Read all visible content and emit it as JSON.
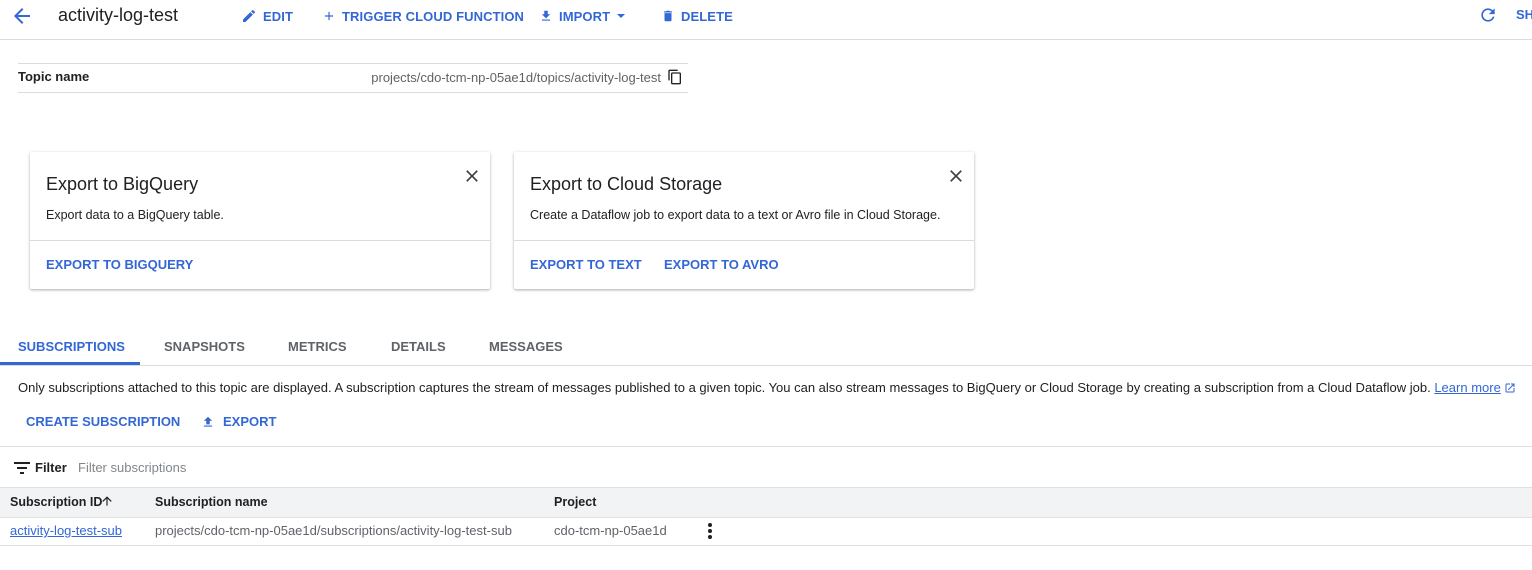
{
  "header": {
    "title": "activity-log-test",
    "actions": {
      "edit": "EDIT",
      "trigger": "TRIGGER CLOUD FUNCTION",
      "import": "IMPORT",
      "delete": "DELETE",
      "share": "SH"
    }
  },
  "topic": {
    "label": "Topic name",
    "value": "projects/cdo-tcm-np-05ae1d/topics/activity-log-test"
  },
  "cards": [
    {
      "title": "Export to BigQuery",
      "description": "Export data to a BigQuery table.",
      "actions": [
        "EXPORT TO BIGQUERY"
      ]
    },
    {
      "title": "Export to Cloud Storage",
      "description": "Create a Dataflow job to export data to a text or Avro file in Cloud Storage.",
      "actions": [
        "EXPORT TO TEXT",
        "EXPORT TO AVRO"
      ]
    }
  ],
  "tabs": [
    "SUBSCRIPTIONS",
    "SNAPSHOTS",
    "METRICS",
    "DETAILS",
    "MESSAGES"
  ],
  "info": {
    "text": "Only subscriptions attached to this topic are displayed. A subscription captures the stream of messages published to a given topic. You can also stream messages to BigQuery or Cloud Storage by creating a subscription from a Cloud Dataflow job.",
    "link": "Learn more"
  },
  "subscription_actions": {
    "create": "CREATE SUBSCRIPTION",
    "export": "EXPORT"
  },
  "filter": {
    "label": "Filter",
    "placeholder": "Filter subscriptions"
  },
  "table": {
    "columns": [
      "Subscription ID",
      "Subscription name",
      "Project"
    ],
    "rows": [
      {
        "id": "activity-log-test-sub",
        "name": "projects/cdo-tcm-np-05ae1d/subscriptions/activity-log-test-sub",
        "project": "cdo-tcm-np-05ae1d"
      }
    ]
  },
  "colors": {
    "accent": "#3367d6",
    "text": "#202124",
    "muted": "#5f6368",
    "divider": "#dadce0",
    "header_bg": "#f1f3f4"
  }
}
